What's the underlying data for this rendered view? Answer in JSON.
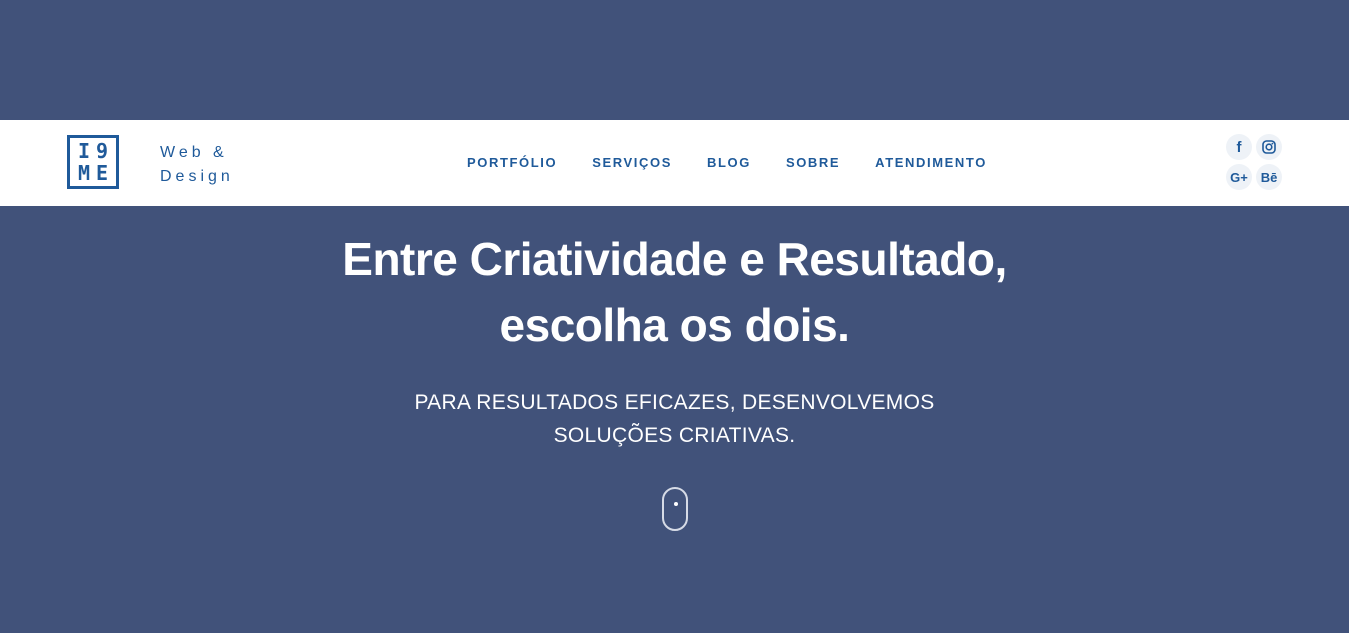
{
  "logo": {
    "chars": [
      "I",
      "9",
      "M",
      "E"
    ],
    "tagline_line1": "Web &",
    "tagline_line2": "Design"
  },
  "nav": {
    "items": [
      {
        "label": "PORTFÓLIO"
      },
      {
        "label": "SERVIÇOS"
      },
      {
        "label": "BLOG"
      },
      {
        "label": "SOBRE"
      },
      {
        "label": "ATENDIMENTO"
      }
    ]
  },
  "social": {
    "facebook_label": "f",
    "instagram_icon": "instagram-icon",
    "googleplus_label": "G+",
    "behance_label": "Bē"
  },
  "hero": {
    "title_line1": "Entre Criatividade e Resultado,",
    "title_line2": "escolha os dois.",
    "subtitle_line1": "PARA RESULTADOS EFICAZES, DESENVOLVEMOS",
    "subtitle_line2": "SOLUÇÕES CRIATIVAS."
  },
  "colors": {
    "background": "#41527a",
    "header": "#ffffff",
    "brand_blue": "#1f5a9a",
    "social_bg": "#eef2f7"
  }
}
